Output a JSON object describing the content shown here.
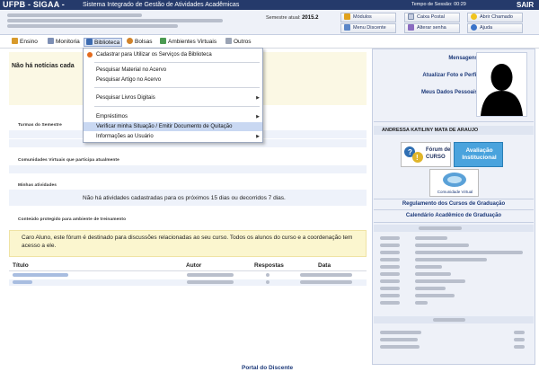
{
  "header": {
    "brand": "UFPB - SIGAA -",
    "system": "Sistema Integrado de Gestão de Atividades Acadêmicas",
    "session_time": "Tempo de Sessão: 00:29",
    "logout": "SAIR",
    "bg_color": "#253a6b"
  },
  "info": {
    "semester_label": "Semestre atual:",
    "semester_value": "2015.2"
  },
  "quick_links": [
    {
      "label": "Módulos",
      "icon": "modules-icon"
    },
    {
      "label": "Caixa Postal",
      "icon": "mailbox-icon"
    },
    {
      "label": "Abrir Chamado",
      "icon": "help-ticket-icon"
    },
    {
      "label": "Menu Discente",
      "icon": "student-menu-icon"
    },
    {
      "label": "Alterar senha",
      "icon": "password-icon"
    },
    {
      "label": "Ajuda",
      "icon": "help-icon"
    }
  ],
  "menu": [
    {
      "label": "Ensino",
      "icon": "teaching-icon"
    },
    {
      "label": "Monitoria",
      "icon": "monitoring-icon"
    },
    {
      "label": "Biblioteca",
      "icon": "library-icon"
    },
    {
      "label": "Bolsas",
      "icon": "scholarship-icon"
    },
    {
      "label": "Ambientes Virtuais",
      "icon": "virtual-env-icon"
    },
    {
      "label": "Outros",
      "icon": "others-icon"
    }
  ],
  "dropdown": {
    "items": [
      "Cadastrar para Utilizar os Serviços da Biblioteca",
      "Pesquisar Material no Acervo",
      "Pesquisar Artigo no Acervo",
      "Pesquisar Livros Digitais",
      "Empréstimos",
      "Verificar minha Situação / Emitir Documento de Quitação",
      "Informações ao Usuário"
    ]
  },
  "main": {
    "news_title": "Não há notícias cada",
    "sections": {
      "turmas": "Turmas do Semestre",
      "comunidades": "Comunidades Virtuais que participa atualmente",
      "atividades": "Minhas atividades",
      "conteudo": "Conteúdo protegido para ambiente de treinamento"
    },
    "no_activities": "Não há atividades cadastradas para os próximos 15 dias ou decorridos 7 dias.",
    "forum_message": "Caro Aluno, este fórum é destinado para discussões relacionadas ao seu curso. Todos os alunos do curso e a coordenação tem acesso a ele.",
    "table_headers": [
      "Título",
      "Autor",
      "Respostas",
      "Data"
    ],
    "table_rows_count": 2
  },
  "right_panel": {
    "links": [
      "Mensagens",
      "Atualizar Foto e Perfil",
      "Meus Dados Pessoais"
    ],
    "student_name": "ANDRESSA KATILINY MATA DE ARAUJO",
    "forum_badge": "Fórum de CURSO",
    "eval_badge": "Avaliação Institucional",
    "cv_badge": "Comunidade Virtual",
    "regulamento": "Regulamento dos Cursos de Graduação",
    "calendario": "Calendário Acadêmico de Graduação"
  },
  "footer": {
    "link": "Portal do Discente"
  }
}
